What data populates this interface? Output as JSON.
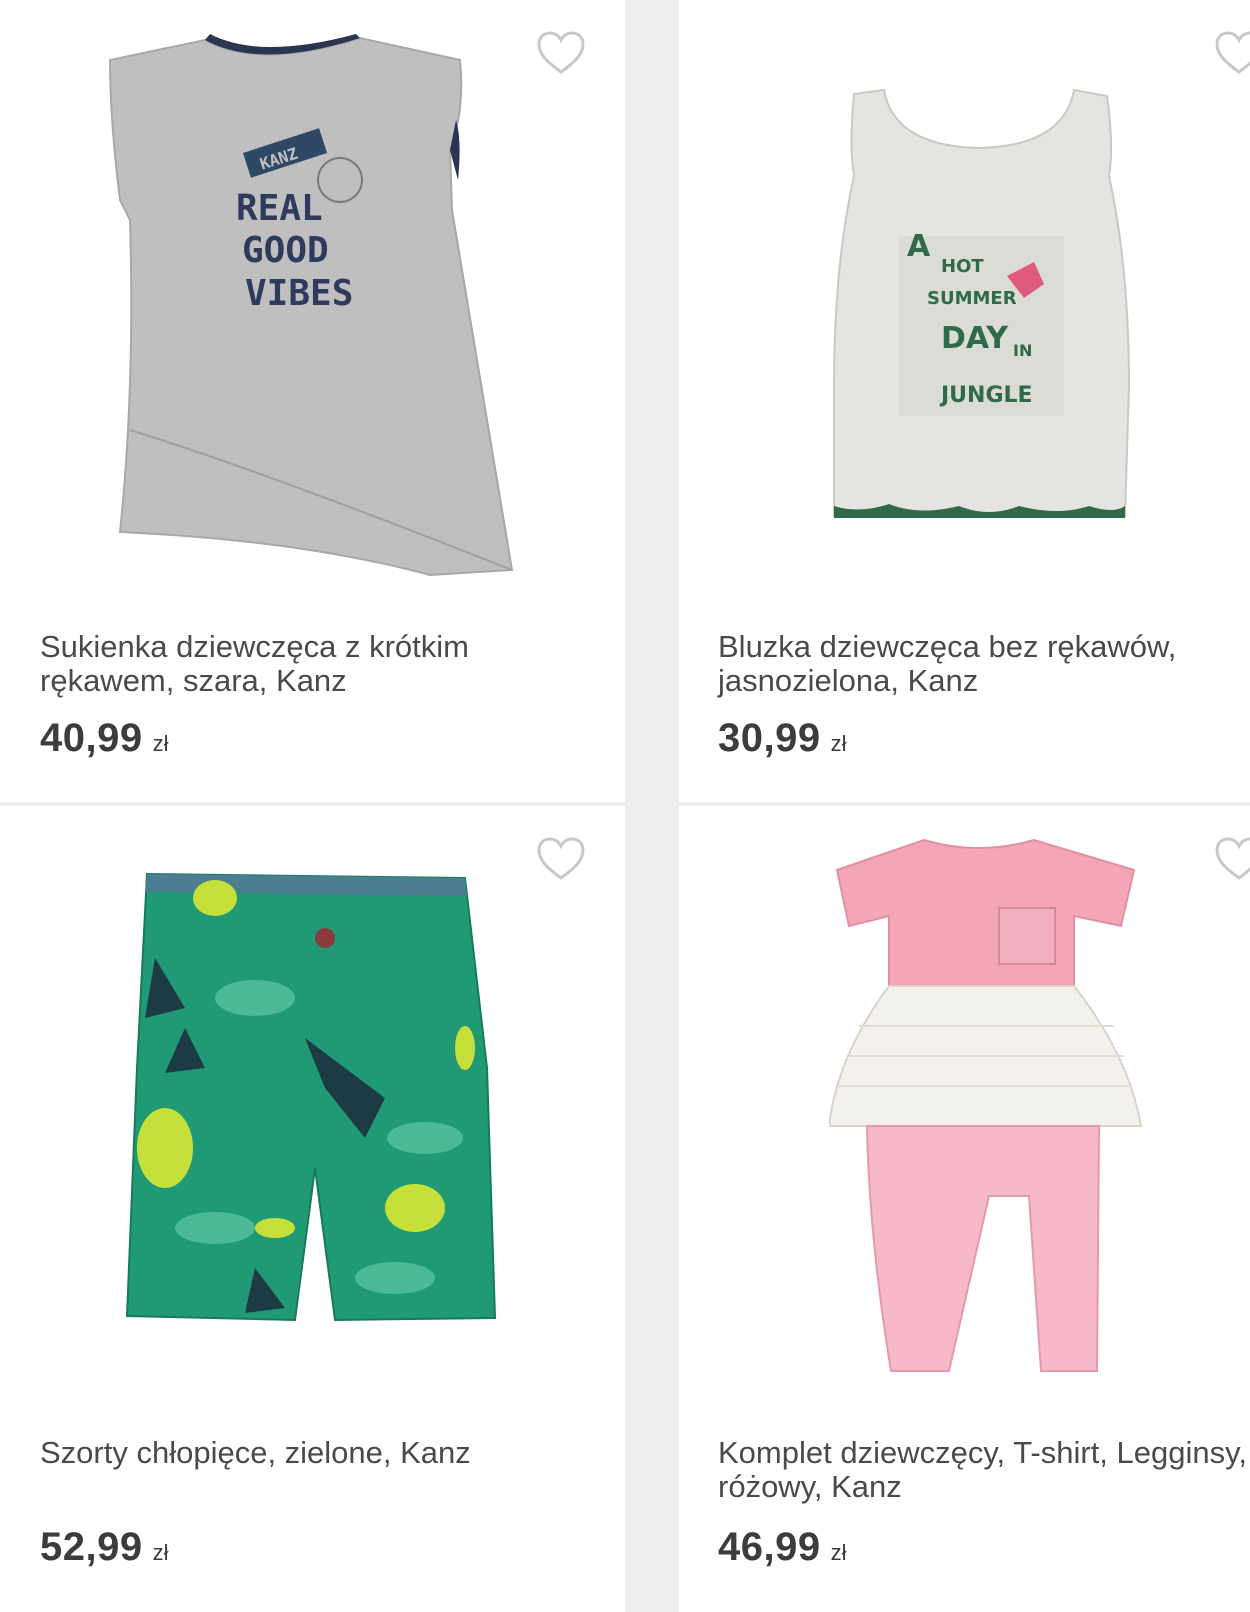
{
  "products": [
    {
      "title": "Sukienka dziewczęca z krótkim rękawem, szara, Kanz",
      "price": "40,99",
      "currency": "zł",
      "image_print": [
        "KANZ",
        "REAL",
        "GOOD",
        "VIBES"
      ],
      "favorite_icon": "heart-outline-icon"
    },
    {
      "title": "Bluzka dziewczęca bez rękawów, jasnozielona, Kanz",
      "price": "30,99",
      "currency": "zł",
      "image_print": [
        "A",
        "HOT",
        "SUMMER",
        "DAY",
        "IN",
        "JUNGLE"
      ],
      "favorite_icon": "heart-outline-icon"
    },
    {
      "title": "Szorty chłopięce, zielone, Kanz",
      "price": "52,99",
      "currency": "zł",
      "favorite_icon": "heart-outline-icon"
    },
    {
      "title": "Komplet dziewczęcy, T-shirt, Legginsy, różowy, Kanz",
      "price": "46,99",
      "currency": "zł",
      "favorite_icon": "heart-outline-icon"
    }
  ],
  "colors": {
    "background": "#eeeeee",
    "card": "#ffffff",
    "text": "#4a4a4a",
    "heart_stroke": "#c8c8c8"
  }
}
